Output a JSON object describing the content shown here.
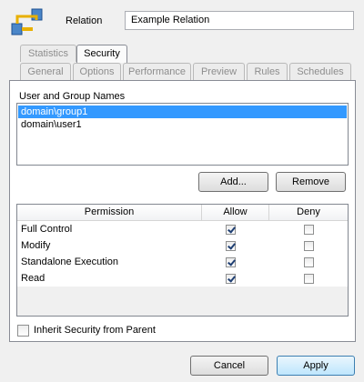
{
  "header": {
    "label": "Relation",
    "name_value": "Example Relation",
    "icon": "relation-icon"
  },
  "tabs_back": [
    {
      "label": "Statistics",
      "active": false
    },
    {
      "label": "Security",
      "active": true
    }
  ],
  "tabs_front": [
    {
      "label": "General"
    },
    {
      "label": "Options"
    },
    {
      "label": "Performance"
    },
    {
      "label": "Preview"
    },
    {
      "label": "Rules"
    },
    {
      "label": "Schedules"
    }
  ],
  "users": {
    "label": "User and Group Names",
    "items": [
      {
        "name": "domain\\group1",
        "selected": true
      },
      {
        "name": "domain\\user1",
        "selected": false
      }
    ],
    "add_label": "Add...",
    "remove_label": "Remove"
  },
  "permissions": {
    "headers": {
      "permission": "Permission",
      "allow": "Allow",
      "deny": "Deny"
    },
    "rows": [
      {
        "name": "Full Control",
        "allow": true,
        "deny": false
      },
      {
        "name": "Modify",
        "allow": true,
        "deny": false
      },
      {
        "name": "Standalone Execution",
        "allow": true,
        "deny": false
      },
      {
        "name": "Read",
        "allow": true,
        "deny": false
      }
    ]
  },
  "inherit": {
    "label": "Inherit Security from Parent",
    "checked": false
  },
  "footer": {
    "cancel_label": "Cancel",
    "apply_label": "Apply"
  }
}
